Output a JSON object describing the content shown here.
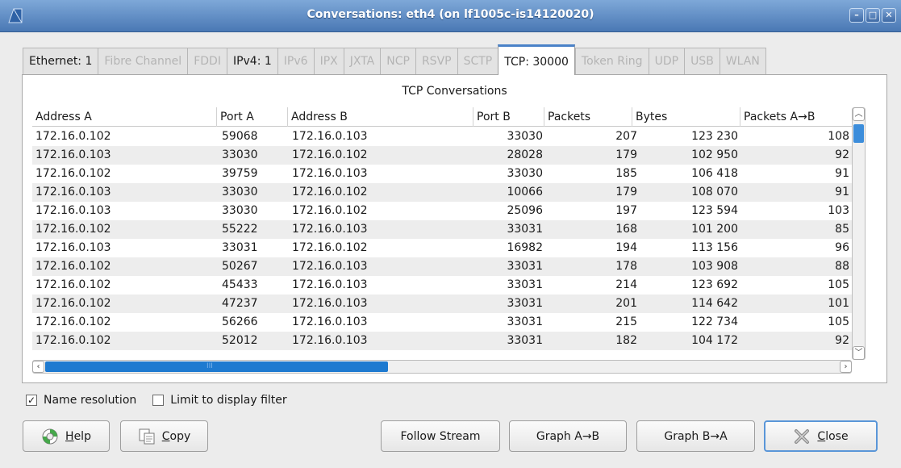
{
  "window": {
    "title": "Conversations: eth4 (on lf1005c-is14120020)",
    "buttons": [
      "–",
      "□",
      "✕"
    ]
  },
  "tabs": [
    {
      "label": "Ethernet: 1",
      "enabled": true
    },
    {
      "label": "Fibre Channel",
      "enabled": false
    },
    {
      "label": "FDDI",
      "enabled": false
    },
    {
      "label": "IPv4: 1",
      "enabled": true
    },
    {
      "label": "IPv6",
      "enabled": false
    },
    {
      "label": "IPX",
      "enabled": false
    },
    {
      "label": "JXTA",
      "enabled": false
    },
    {
      "label": "NCP",
      "enabled": false
    },
    {
      "label": "RSVP",
      "enabled": false
    },
    {
      "label": "SCTP",
      "enabled": false
    },
    {
      "label": "TCP: 30000",
      "enabled": true,
      "active": true
    },
    {
      "label": "Token Ring",
      "enabled": false
    },
    {
      "label": "UDP",
      "enabled": false
    },
    {
      "label": "USB",
      "enabled": false
    },
    {
      "label": "WLAN",
      "enabled": false
    }
  ],
  "table": {
    "title": "TCP Conversations",
    "columns": [
      "Address A",
      "Port A",
      "Address B",
      "Port B",
      "Packets",
      "Bytes",
      "Packets A→B"
    ],
    "rows": [
      [
        "172.16.0.102",
        "59068",
        "172.16.0.103",
        "33030",
        "207",
        "123 230",
        "108"
      ],
      [
        "172.16.0.103",
        "33030",
        "172.16.0.102",
        "28028",
        "179",
        "102 950",
        "92"
      ],
      [
        "172.16.0.102",
        "39759",
        "172.16.0.103",
        "33030",
        "185",
        "106 418",
        "91"
      ],
      [
        "172.16.0.103",
        "33030",
        "172.16.0.102",
        "10066",
        "179",
        "108 070",
        "91"
      ],
      [
        "172.16.0.103",
        "33030",
        "172.16.0.102",
        "25096",
        "197",
        "123 594",
        "103"
      ],
      [
        "172.16.0.102",
        "55222",
        "172.16.0.103",
        "33031",
        "168",
        "101 200",
        "85"
      ],
      [
        "172.16.0.103",
        "33031",
        "172.16.0.102",
        "16982",
        "194",
        "113 156",
        "96"
      ],
      [
        "172.16.0.102",
        "50267",
        "172.16.0.103",
        "33031",
        "178",
        "103 908",
        "88"
      ],
      [
        "172.16.0.102",
        "45433",
        "172.16.0.103",
        "33031",
        "214",
        "123 692",
        "105"
      ],
      [
        "172.16.0.102",
        "47237",
        "172.16.0.103",
        "33031",
        "201",
        "114 642",
        "101"
      ],
      [
        "172.16.0.102",
        "56266",
        "172.16.0.103",
        "33031",
        "215",
        "122 734",
        "105"
      ],
      [
        "172.16.0.102",
        "52012",
        "172.16.0.103",
        "33031",
        "182",
        "104 172",
        "92"
      ]
    ]
  },
  "options": {
    "name_resolution": {
      "label": "Name resolution",
      "checked": true
    },
    "limit_filter": {
      "label": "Limit to display filter",
      "checked": false
    }
  },
  "buttons": {
    "help": {
      "label_prefix": "",
      "mnemonic": "H",
      "label_rest": "elp"
    },
    "copy": {
      "mnemonic": "C",
      "label_rest": "opy"
    },
    "follow_stream": "Follow Stream",
    "graph_ab": "Graph A→B",
    "graph_ba": "Graph B→A",
    "close": {
      "mnemonic": "C",
      "label_rest": "lose"
    }
  },
  "icons": {
    "app": "wireshark-fin-icon",
    "help": "lifebuoy-icon",
    "copy": "copy-icon",
    "close": "close-x-icon"
  },
  "colors": {
    "titlebar": "#4a78b4",
    "accent": "#4a82c8",
    "scroll_thumb": "#1e7ad0"
  }
}
